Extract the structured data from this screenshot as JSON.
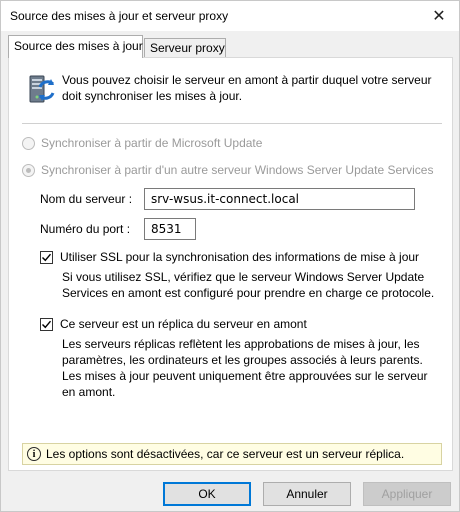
{
  "window": {
    "title": "Source des mises à jour et serveur proxy",
    "close_symbol": "✕"
  },
  "tabs": [
    {
      "label": "Source des mises à jour",
      "active": true
    },
    {
      "label": "Serveur proxy",
      "active": false
    }
  ],
  "intro": {
    "icon": "server-update-icon",
    "text": "Vous pouvez choisir le serveur en amont à partir duquel votre serveur doit synchroniser les mises à jour."
  },
  "options": {
    "microsoft_update": {
      "label": "Synchroniser à partir de Microsoft Update",
      "selected": false,
      "disabled": true
    },
    "other_server": {
      "label": "Synchroniser à partir d'un autre serveur Windows Server Update Services",
      "selected": true,
      "disabled": true
    }
  },
  "server_name": {
    "label": "Nom du serveur :",
    "value": "srv-wsus.it-connect.local"
  },
  "port": {
    "label": "Numéro du port :",
    "value": "8531"
  },
  "ssl": {
    "label": "Utiliser SSL pour la synchronisation des informations de mise à jour",
    "checked": true,
    "description": "Si vous utilisez SSL, vérifiez que le serveur Windows Server Update Services en amont est configuré pour prendre en charge ce protocole."
  },
  "replica": {
    "label": "Ce serveur est un réplica du serveur en amont",
    "checked": true,
    "description": "Les serveurs réplicas reflètent les approbations de mises à jour, les paramètres, les ordinateurs et les groupes associés à leurs parents. Les mises à jour peuvent uniquement être approuvées sur le serveur en amont."
  },
  "info_bar": {
    "icon": "info-icon",
    "glyph": "i",
    "text": "Les options sont désactivées, car ce serveur est un serveur réplica."
  },
  "buttons": {
    "ok": "OK",
    "cancel": "Annuler",
    "apply": "Appliquer"
  },
  "colors": {
    "accent": "#0078d7",
    "info_background": "#fffde3",
    "disabled_text": "#9a9a9a"
  }
}
